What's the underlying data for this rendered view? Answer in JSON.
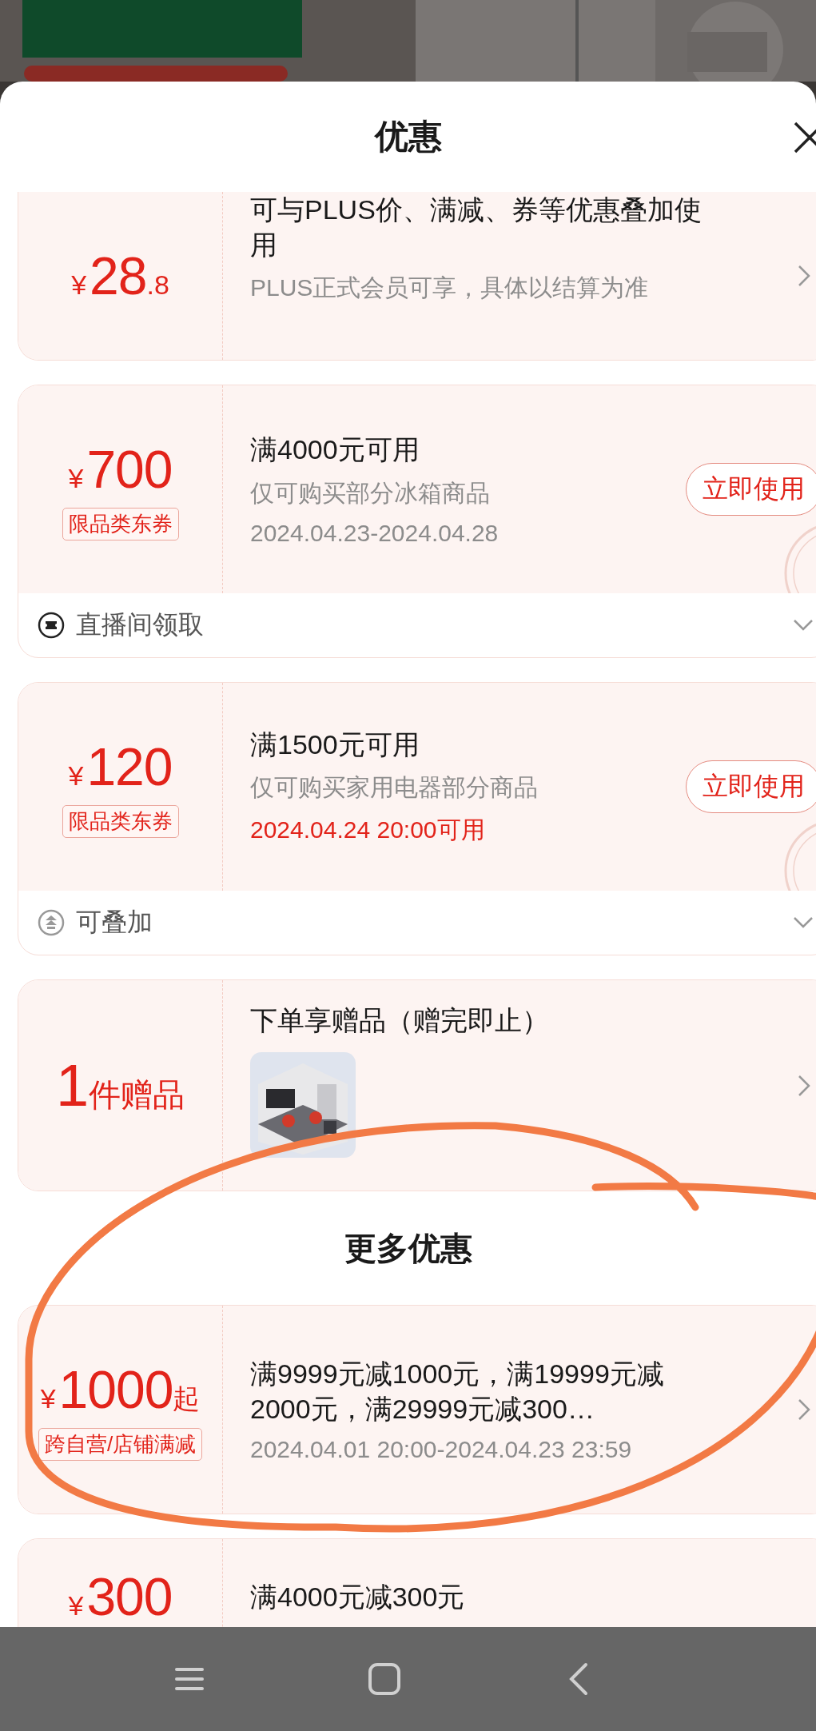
{
  "sheet": {
    "title": "优惠"
  },
  "offers": [
    {
      "kind": "coupon",
      "clipped_top": true,
      "amount": {
        "currency": "¥",
        "value": "28",
        "decimal": ".8"
      },
      "title": "可与PLUS价、满减、券等优惠叠加使用",
      "note": "PLUS正式会员可享，具体以结算为准",
      "chevron": true
    },
    {
      "kind": "coupon",
      "amount": {
        "currency": "¥",
        "value": "700"
      },
      "tag": "限品类东券",
      "title": "满4000元可用",
      "note": "仅可购买部分冰箱商品",
      "date": {
        "text": "2024.04.23-2024.04.28",
        "highlight": false
      },
      "button": "立即使用",
      "claimed": true,
      "footer": {
        "kind": "live",
        "text": "直播间领取"
      }
    },
    {
      "kind": "coupon",
      "amount": {
        "currency": "¥",
        "value": "120"
      },
      "tag": "限品类东券",
      "title": "满1500元可用",
      "note": "仅可购买家用电器部分商品",
      "date": {
        "text": "2024.04.24 20:00可用",
        "highlight": true
      },
      "button": "立即使用",
      "claimed": true,
      "footer": {
        "kind": "stack",
        "text": "可叠加"
      }
    },
    {
      "kind": "gift",
      "count": "1",
      "unit": "件赠品",
      "title": "下单享赠品（赠完即止）",
      "chevron": true
    }
  ],
  "more": {
    "title": "更多优惠",
    "offers": [
      {
        "kind": "coupon",
        "amount": {
          "currency": "¥",
          "value": "1000",
          "suffix": "起"
        },
        "tag": "跨自营/店铺满减",
        "title": "满9999元减1000元，满19999元减2000元，满29999元减300…",
        "date": {
          "text": "2024.04.01 20:00-2024.04.23 23:59",
          "highlight": false
        },
        "chevron": true
      },
      {
        "kind": "coupon",
        "partial": true,
        "amount": {
          "currency": "¥",
          "value": "300"
        },
        "title": "满4000元减300元"
      }
    ]
  },
  "annotation": {
    "kind": "circle"
  },
  "nav_bar": {
    "buttons": [
      {
        "kind": "menu"
      },
      {
        "kind": "home"
      },
      {
        "kind": "back"
      }
    ]
  }
}
